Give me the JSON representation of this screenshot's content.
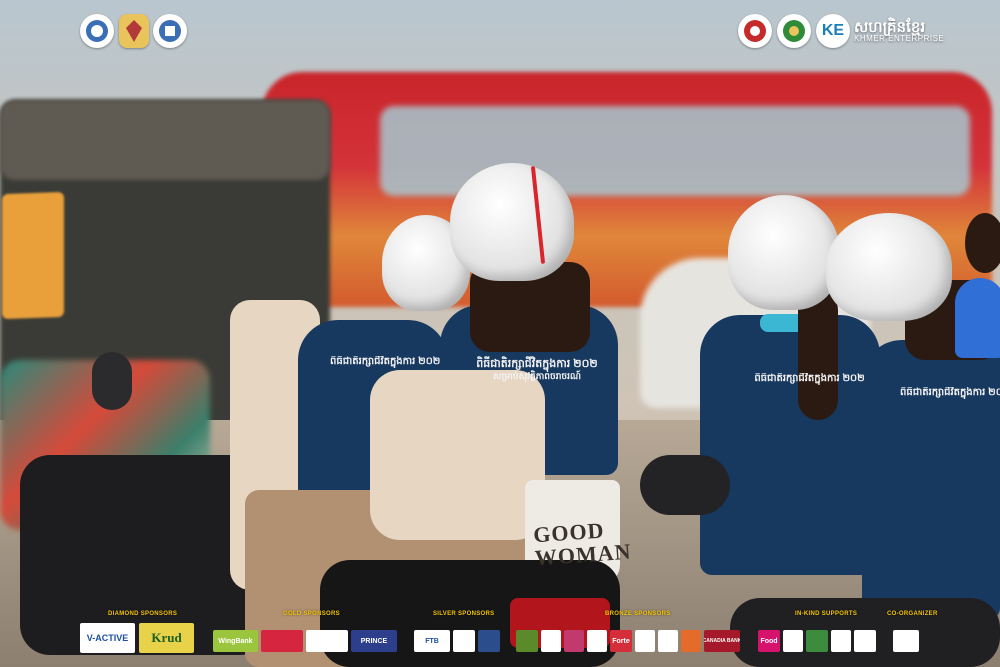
{
  "header": {
    "brand_khmer": "សហគ្រិនខ្មែរ",
    "brand_latin": "KHMER ENTERPRISE",
    "brand_mark": "KE"
  },
  "shirt": {
    "line1": "ពិធីជាតិរក្សាជីវិតក្នុងការ ២០២",
    "line2": "សម្រាប់សុវត្ថិភាពចរាចរណ៍"
  },
  "bag": {
    "line1": "GOOD",
    "line2": "WOMAN"
  },
  "sponsors": {
    "categories": [
      "DIAMOND SPONSORS",
      "GOLD SPONSORS",
      "SILVER SPONSORS",
      "BRONZE SPONSORS",
      "IN-KIND SUPPORTS",
      "CO-ORGANIZER"
    ],
    "logos": {
      "vactive": "V-ACTIVE",
      "krud": "Krud",
      "wingbank": "WingBank",
      "prince": "PRINCE",
      "ftb": "FTB",
      "forte": "Forte",
      "canadia": "CANADIA BANK",
      "foodpanda": "Food"
    }
  },
  "colors": {
    "sponsor_heading": "#f4c400",
    "shirt_navy": "#17385f",
    "bus_red": "#c9252b"
  }
}
